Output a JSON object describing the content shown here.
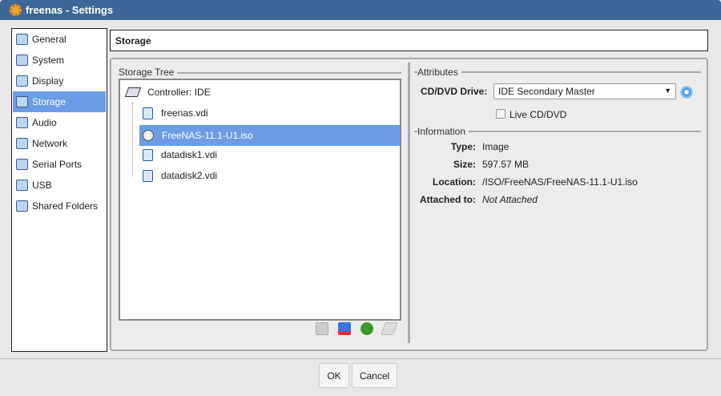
{
  "window": {
    "title": "freenas - Settings"
  },
  "sidebar": {
    "items": [
      {
        "label": "General"
      },
      {
        "label": "System"
      },
      {
        "label": "Display"
      },
      {
        "label": "Storage"
      },
      {
        "label": "Audio"
      },
      {
        "label": "Network"
      },
      {
        "label": "Serial Ports"
      },
      {
        "label": "USB"
      },
      {
        "label": "Shared Folders"
      }
    ]
  },
  "header": {
    "title": "Storage"
  },
  "tree": {
    "legend": "Storage Tree",
    "controller": "Controller: IDE",
    "items": [
      {
        "label": "freenas.vdi",
        "type": "disk"
      },
      {
        "label": "FreeNAS-11.1-U1.iso",
        "type": "cd"
      },
      {
        "label": "datadisk1.vdi",
        "type": "disk"
      },
      {
        "label": "datadisk2.vdi",
        "type": "disk"
      }
    ]
  },
  "attributes": {
    "legend": "Attributes",
    "drive_label": "CD/DVD Drive:",
    "drive_value": "IDE Secondary Master",
    "live_label": "Live CD/DVD",
    "live_checked": false
  },
  "information": {
    "legend": "Information",
    "type_label": "Type:",
    "type_value": "Image",
    "size_label": "Size:",
    "size_value": "597.57 MB",
    "location_label": "Location:",
    "location_value": "/ISO/FreeNAS/FreeNAS-11.1-U1.iso",
    "attached_label": "Attached to:",
    "attached_value": "Not Attached"
  },
  "buttons": {
    "ok": "OK",
    "cancel": "Cancel"
  }
}
